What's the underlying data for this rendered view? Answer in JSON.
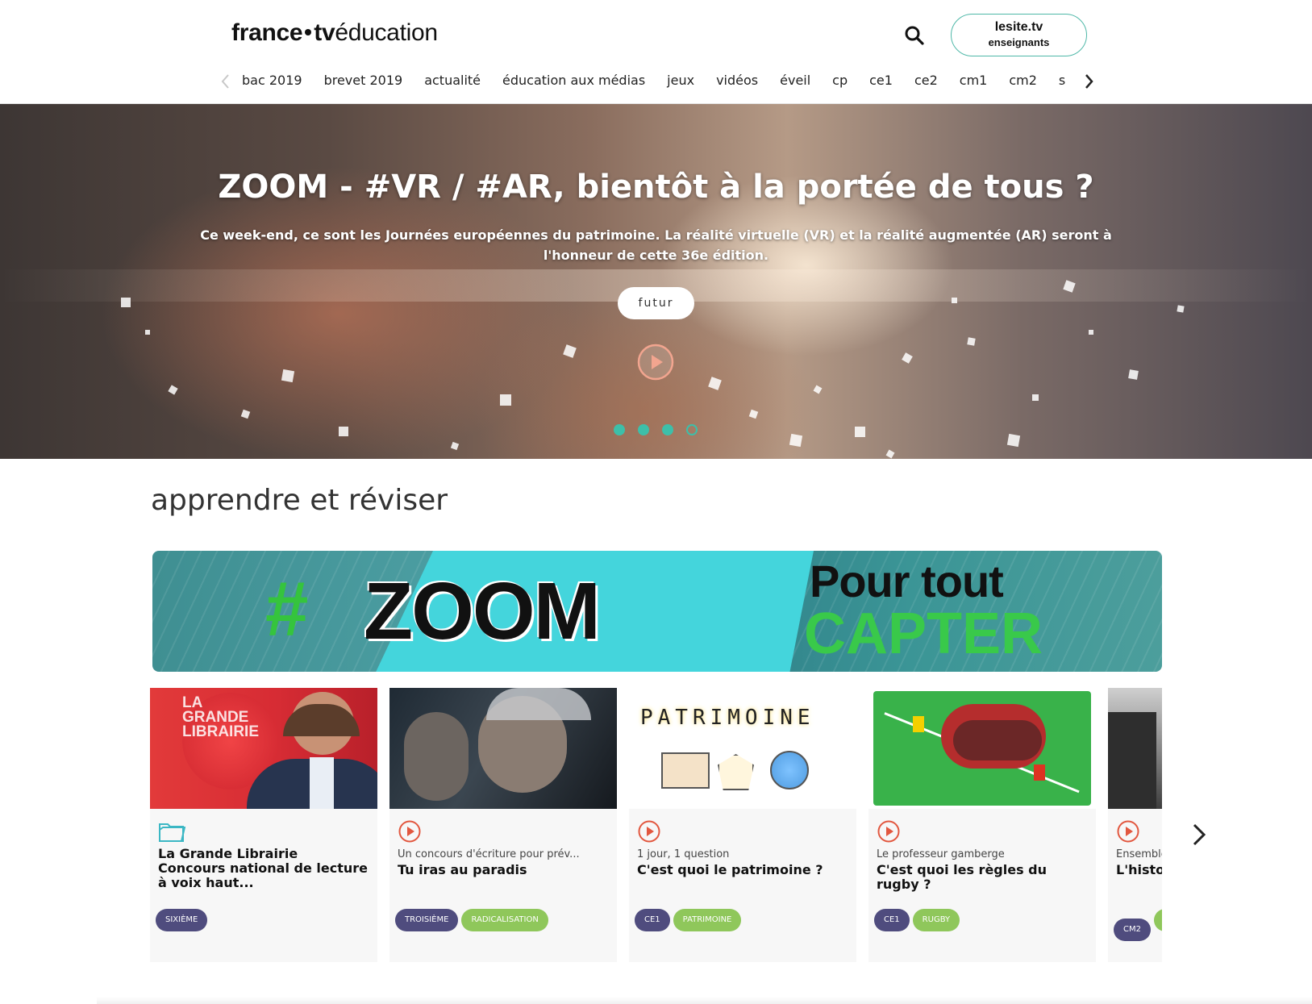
{
  "header": {
    "logo_bold": "france",
    "logo_tv": "tv",
    "logo_thin": "éducation",
    "search_icon": "search-icon",
    "lesite_line1": "lesite.tv",
    "lesite_line2": "enseignants",
    "accent_color": "#4fb8a8"
  },
  "nav": {
    "items": [
      "bac 2019",
      "brevet 2019",
      "actualité",
      "éducation aux médias",
      "jeux",
      "vidéos",
      "éveil",
      "cp",
      "ce1",
      "ce2",
      "cm1",
      "cm2",
      "s"
    ],
    "left_icon": "chevron-left-icon",
    "right_icon": "chevron-right-icon"
  },
  "hero": {
    "title": "ZOOM - #VR / #AR, bientôt à la portée de tous ?",
    "description": "Ce week-end, ce sont les Journées européennes du patrimoine. La réalité virtuelle (VR) et la réalité augmentée (AR) seront à l'honneur de cette 36e édition.",
    "tag": "futur",
    "play_icon": "play-circle-icon",
    "slide_count": 4,
    "active_slide": 4,
    "dot_color": "#3dbfa9"
  },
  "section": {
    "title": "apprendre et réviser"
  },
  "banner": {
    "hash": "#",
    "zoom": "ZOOM",
    "line1": "Pour tout",
    "line2": "CAPTER"
  },
  "cards": [
    {
      "icon": "folder-icon",
      "subtitle": "",
      "title": "La Grande Librairie Concours national de lecture à voix haut...",
      "tags": [
        {
          "label": "SIXIÈME",
          "kind": "level"
        }
      ],
      "thumb_text": "LA GRANDE LIBRAIRIE"
    },
    {
      "icon": "play-circle-icon",
      "subtitle": "Un concours d'écriture pour prév...",
      "title": "Tu iras au paradis",
      "tags": [
        {
          "label": "TROISIÈME",
          "kind": "level"
        },
        {
          "label": "RADICALISATION",
          "kind": "theme"
        }
      ],
      "thumb_text": ""
    },
    {
      "icon": "play-circle-icon",
      "subtitle": "1 jour, 1 question",
      "title": "C'est quoi le patrimoine ?",
      "tags": [
        {
          "label": "CE1",
          "kind": "level"
        },
        {
          "label": "PATRIMOINE",
          "kind": "theme"
        }
      ],
      "thumb_text": "PATRIMOINE"
    },
    {
      "icon": "play-circle-icon",
      "subtitle": "Le professeur gamberge",
      "title": "C'est quoi les règles du rugby ?",
      "tags": [
        {
          "label": "CE1",
          "kind": "level"
        },
        {
          "label": "RUGBY",
          "kind": "theme"
        }
      ],
      "thumb_text": ""
    },
    {
      "icon": "play-circle-icon",
      "subtitle": "Ensemble",
      "title": "L'histo",
      "tags": [
        {
          "label": "CM2",
          "kind": "level"
        },
        {
          "label": "",
          "kind": "theme"
        }
      ],
      "thumb_text": ""
    }
  ],
  "cards_next_icon": "chevron-right-icon"
}
